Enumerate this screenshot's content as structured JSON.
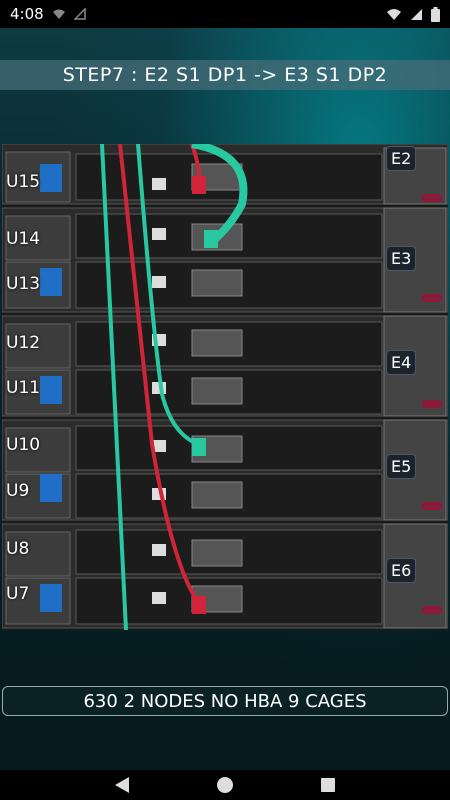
{
  "status_bar": {
    "time": "4:08"
  },
  "step_title": "STEP7 : E2 S1 DP1 -> E3 S1 DP2",
  "units": [
    "U15",
    "U14",
    "U13",
    "U12",
    "U11",
    "U10",
    "U9",
    "U8",
    "U7"
  ],
  "cages": [
    "E2",
    "E3",
    "E4",
    "E5",
    "E6"
  ],
  "footer_label": "630 2 NODES NO HBA 9 CAGES",
  "colors": {
    "cable_red": "#d0243a",
    "cable_teal": "#28c8a0",
    "step_bar": "#466e78"
  },
  "nav": {
    "back": "back-icon",
    "home": "home-icon",
    "recents": "recents-icon"
  }
}
